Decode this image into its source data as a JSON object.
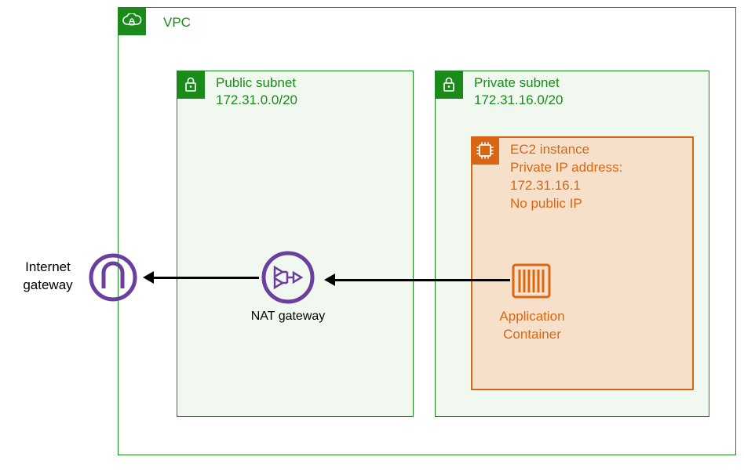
{
  "diagram": {
    "vpc": {
      "label": "VPC"
    },
    "public_subnet": {
      "label": "Public subnet",
      "cidr": "172.31.0.0/20"
    },
    "private_subnet": {
      "label": "Private subnet",
      "cidr": "172.31.16.0/20"
    },
    "ec2": {
      "title": "EC2 instance",
      "ip_label": "Private IP address:",
      "ip_value": "172.31.16.1",
      "public_ip": "No public IP"
    },
    "app_container": {
      "label_line1": "Application",
      "label_line2": "Container"
    },
    "nat_gateway": {
      "label": "NAT gateway"
    },
    "internet_gateway": {
      "label_line1": "Internet",
      "label_line2": "gateway"
    }
  },
  "chart_data": {
    "type": "diagram",
    "description": "AWS VPC network architecture",
    "nodes": [
      {
        "id": "internet-gateway",
        "label": "Internet gateway",
        "type": "gateway"
      },
      {
        "id": "vpc",
        "label": "VPC",
        "type": "vpc"
      },
      {
        "id": "public-subnet",
        "label": "Public subnet",
        "cidr": "172.31.0.0/20",
        "type": "subnet",
        "parent": "vpc"
      },
      {
        "id": "private-subnet",
        "label": "Private subnet",
        "cidr": "172.31.16.0/20",
        "type": "subnet",
        "parent": "vpc"
      },
      {
        "id": "nat-gateway",
        "label": "NAT gateway",
        "type": "nat",
        "parent": "public-subnet"
      },
      {
        "id": "ec2-instance",
        "label": "EC2 instance",
        "private_ip": "172.31.16.1",
        "public_ip": "none",
        "type": "instance",
        "parent": "private-subnet"
      },
      {
        "id": "app-container",
        "label": "Application Container",
        "type": "container",
        "parent": "ec2-instance"
      }
    ],
    "edges": [
      {
        "from": "app-container",
        "to": "nat-gateway",
        "direction": "outbound"
      },
      {
        "from": "nat-gateway",
        "to": "internet-gateway",
        "direction": "outbound"
      }
    ]
  }
}
